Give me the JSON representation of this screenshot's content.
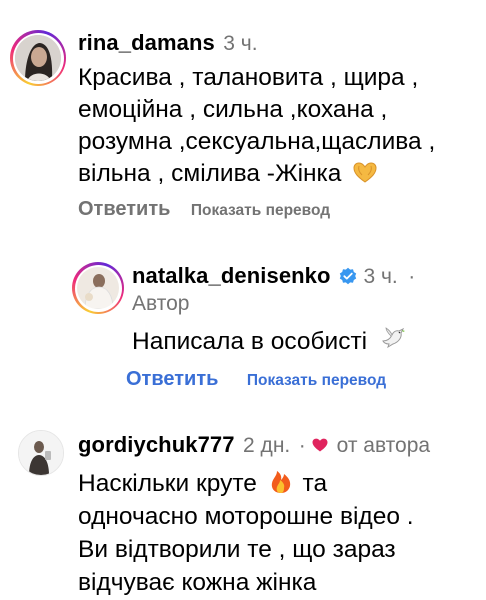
{
  "comments": [
    {
      "username": "rina_damans",
      "time": "3 ч.",
      "lines": [
        "Красива , талановита , щира ,",
        "емоційна , сильна ,кохана ,",
        "розумна ,сексуальна,щаслива ,",
        "вільна , смілива -Жінка"
      ],
      "emoji_icon": "heart-hands-emoji",
      "reply_label": "Ответить",
      "translate_label": "Показать перевод"
    },
    {
      "username": "natalka_denisenko",
      "time": "3 ч.",
      "separator": "·",
      "author_label": "Автор",
      "verified_icon": "verified-badge-icon",
      "text": "Написала в особисті",
      "emoji_icon": "dove-emoji",
      "reply_label": "Ответить",
      "translate_label": "Показать перевод",
      "accent": "#3a6fd6"
    },
    {
      "username": "gordiychuk777",
      "time": "2 дн.",
      "separator": "·",
      "liked_label": "от автора",
      "heart_icon": "heart-icon",
      "heart_color": "#e0245e",
      "lines": [
        "Наскільки круте",
        "одночасно моторошне відео .",
        "Ви відтворили те , що зараз",
        "відчуває кожна жінка"
      ],
      "line1_suffix": "та",
      "emoji_icon": "fire-emoji"
    }
  ]
}
